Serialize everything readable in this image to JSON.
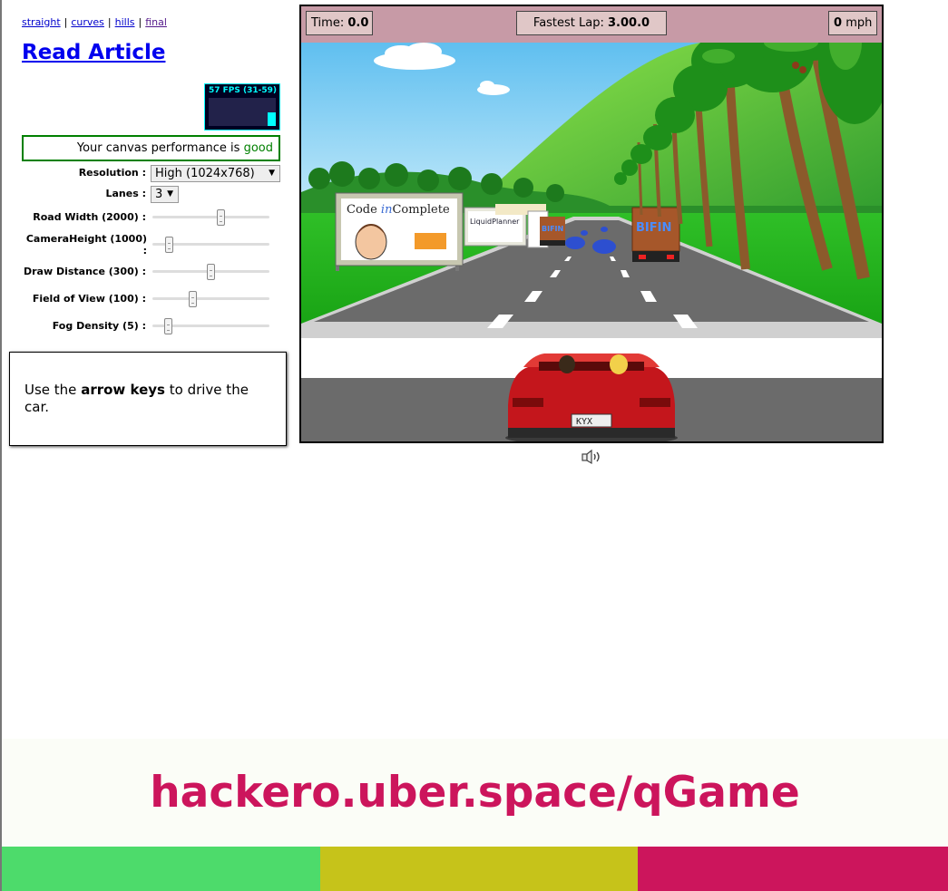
{
  "nav": {
    "links": [
      {
        "label": "straight"
      },
      {
        "label": "curves"
      },
      {
        "label": "hills"
      },
      {
        "label": "final"
      }
    ],
    "separator": "|"
  },
  "read_article": "Read Article",
  "fps_meter": {
    "text": "57 FPS (31-59)",
    "fps": 57
  },
  "performance": {
    "prefix": "Your canvas performance is",
    "rating": "good"
  },
  "controls": {
    "resolution": {
      "label": "Resolution :",
      "selected": "High (1024x768)",
      "arrow": "▼"
    },
    "lanes": {
      "label": "Lanes :",
      "selected": "3",
      "arrow": "▼"
    },
    "road_width": {
      "label": "Road Width (2000) :",
      "value": 2000,
      "min": 500,
      "max": 3000
    },
    "camera_height": {
      "label": "CameraHeight (1000) :",
      "value": 1000,
      "min": 500,
      "max": 5000
    },
    "draw_distance": {
      "label": "Draw Distance (300) :",
      "value": 300,
      "min": 100,
      "max": 500
    },
    "field_of_view": {
      "label": "Field of View (100) :",
      "value": 100,
      "min": 80,
      "max": 140
    },
    "fog_density": {
      "label": "Fog Density (5) :",
      "value": 5,
      "min": 0,
      "max": 50
    }
  },
  "instructions": {
    "pre": "Use the",
    "keys": "arrow keys",
    "post": "to drive the car."
  },
  "hud": {
    "time_label": "Time:",
    "time_value": "0.0",
    "fastest_label": "Fastest Lap:",
    "fastest_value": "3.00.0",
    "speed_value": "0",
    "speed_unit": "mph"
  },
  "billboards": {
    "code_incomplete": {
      "a": "Code ",
      "b": "in",
      "c": "Complete"
    },
    "liquidplanner": "LiquidPlanner",
    "truck_sign": "BIFIN",
    "plate": "KYX"
  },
  "mute_icon": "speaker-icon",
  "banner": {
    "text": "hackero.uber.space/qGame",
    "color": "#cc155c"
  },
  "stripes": [
    {
      "color": "#4ddb6b"
    },
    {
      "color": "#c6c31a"
    },
    {
      "color": "#cc155c"
    }
  ]
}
